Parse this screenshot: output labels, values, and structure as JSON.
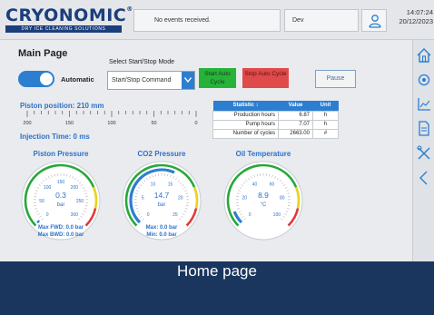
{
  "header": {
    "logo_text": "CRYONOMIC",
    "logo_reg": "®",
    "logo_tagline": "DRY ICE CLEANING SOLUTIONS",
    "events_text": "No events received.",
    "user_name": "Dev",
    "time": "14:07:24",
    "date": "20/12/2023"
  },
  "sidebar": {
    "items": [
      "home-icon",
      "view-icon",
      "chart-icon",
      "report-icon",
      "tools-icon",
      "collapse-icon"
    ]
  },
  "main": {
    "title": "Main Page",
    "automatic_label": "Automatic",
    "automatic_on": true,
    "start_stop": {
      "title": "Select Start/Stop Mode",
      "value": "Start/Stop Command"
    },
    "buttons": {
      "start": "Start Auto Cycle",
      "stop": "Stop Auto Cycle",
      "pause": "Pause"
    },
    "piston_position": "Piston position: 210 mm",
    "scale_labels": [
      "200",
      "150",
      "100",
      "50",
      "0"
    ],
    "injection_time": "Injection Time: 0 ms",
    "stats": {
      "headers": [
        "Statistic ↕",
        "Value",
        "Unit"
      ],
      "rows": [
        {
          "label": "Production hours",
          "value": "6.87",
          "unit": "h"
        },
        {
          "label": "Pump hours",
          "value": "7.07",
          "unit": "h"
        },
        {
          "label": "Number of cycles",
          "value": "2663.00",
          "unit": "#"
        }
      ]
    }
  },
  "gauges": [
    {
      "label": "Piston Pressure",
      "value": "0.3",
      "unit": "bar",
      "value_fraction": 0.001,
      "ticks": [
        "0",
        "50",
        "100",
        "150",
        "200",
        "250",
        "300"
      ],
      "lines": [
        "Max FWD: 0.0 bar",
        "Max BWD: 0.0 bar"
      ]
    },
    {
      "label": "CO2 Pressure",
      "value": "14.7",
      "unit": "bar",
      "value_fraction": 0.59,
      "ticks": [
        "0",
        "5",
        "10",
        "15",
        "20",
        "25"
      ],
      "lines": [
        "Max: 0.0 bar",
        "Min: 0.0 bar"
      ]
    },
    {
      "label": "Oil Temperature",
      "value": "8.9",
      "unit": "°C",
      "value_fraction": 0.09,
      "ticks": [
        "0",
        "20",
        "40",
        "60",
        "80",
        "100"
      ],
      "lines": []
    }
  ],
  "colors": {
    "accent_blue": "#2c7ed0",
    "start_green": "#27b33a",
    "stop_red": "#e04a4a",
    "footer_navy": "#1a365f",
    "gauge_green": "#27a83a",
    "gauge_yellow": "#e8d21e",
    "gauge_red": "#e03a3a"
  },
  "footer": {
    "caption": "Home page"
  }
}
